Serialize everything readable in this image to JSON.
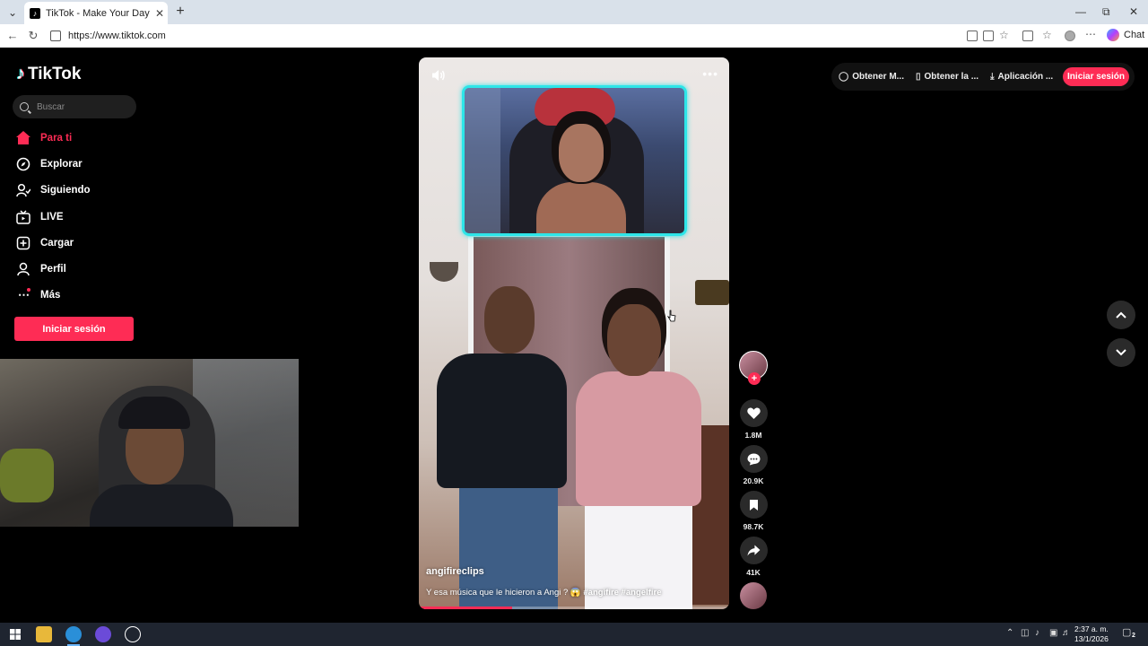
{
  "browser": {
    "tab_title": "TikTok - Make Your Day",
    "url": "https://www.tiktok.com",
    "chat_label": "Chat"
  },
  "sidebar": {
    "logo_text": "TikTok",
    "search_placeholder": "Buscar",
    "items": [
      {
        "label": "Para ti",
        "icon": "home-icon",
        "active": true
      },
      {
        "label": "Explorar",
        "icon": "compass-icon"
      },
      {
        "label": "Siguiendo",
        "icon": "following-icon"
      },
      {
        "label": "LIVE",
        "icon": "live-tv-icon"
      },
      {
        "label": "Cargar",
        "icon": "upload-icon"
      },
      {
        "label": "Perfil",
        "icon": "profile-icon"
      },
      {
        "label": "Más",
        "icon": "more-dots-icon"
      }
    ],
    "login_label": "Iniciar sesión"
  },
  "video": {
    "author": "angifireclips",
    "caption_text": "Y esa música que le hicieron a Angi ? 😱",
    "hashtags": "#angifire #angelfire",
    "progress": 0.3
  },
  "actions": {
    "likes": "1.8M",
    "comments": "20.9K",
    "saves": "98.7K",
    "shares": "41K"
  },
  "topbar": {
    "links": [
      "Obtener M...",
      "Obtener la ...",
      "Aplicación ..."
    ],
    "login_label": "Iniciar sesión"
  },
  "taskbar": {
    "time": "2:37 a. m.",
    "date": "13/1/2026",
    "notifications": "2"
  },
  "colors": {
    "accent": "#fe2c55",
    "pip_border": "#2de5e8"
  }
}
